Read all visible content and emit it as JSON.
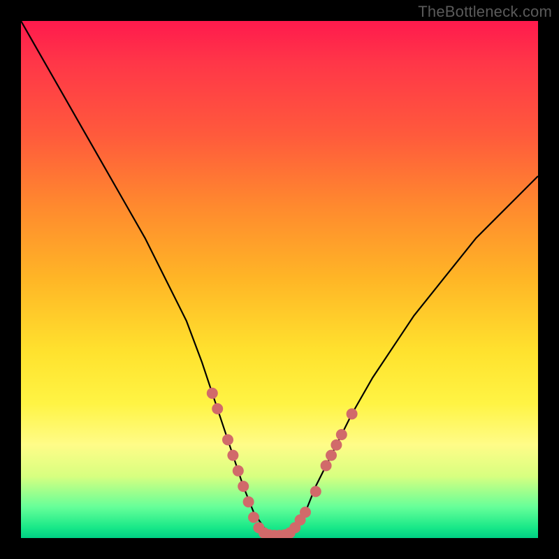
{
  "watermark": "TheBottleneck.com",
  "colors": {
    "curve_stroke": "#000000",
    "marker_fill": "#d16a6a",
    "marker_stroke": "#d16a6a"
  },
  "chart_data": {
    "type": "line",
    "title": "",
    "xlabel": "",
    "ylabel": "",
    "xlim": [
      0,
      100
    ],
    "ylim": [
      0,
      100
    ],
    "series": [
      {
        "name": "curve",
        "x": [
          0,
          4,
          8,
          12,
          16,
          20,
          24,
          28,
          32,
          35,
          37,
          39,
          41,
          43,
          45,
          47,
          49,
          51,
          53,
          55,
          57,
          60,
          64,
          68,
          72,
          76,
          80,
          84,
          88,
          92,
          96,
          100
        ],
        "y": [
          100,
          93,
          86,
          79,
          72,
          65,
          58,
          50,
          42,
          34,
          28,
          22,
          16,
          10,
          5,
          2,
          0.5,
          0.5,
          2,
          5,
          10,
          16,
          24,
          31,
          37,
          43,
          48,
          53,
          58,
          62,
          66,
          70
        ]
      }
    ],
    "markers": [
      {
        "x": 37,
        "y": 28
      },
      {
        "x": 38,
        "y": 25
      },
      {
        "x": 40,
        "y": 19
      },
      {
        "x": 41,
        "y": 16
      },
      {
        "x": 42,
        "y": 13
      },
      {
        "x": 43,
        "y": 10
      },
      {
        "x": 44,
        "y": 7
      },
      {
        "x": 45,
        "y": 4
      },
      {
        "x": 46,
        "y": 2
      },
      {
        "x": 47,
        "y": 1
      },
      {
        "x": 48,
        "y": 0.6
      },
      {
        "x": 49,
        "y": 0.5
      },
      {
        "x": 50,
        "y": 0.5
      },
      {
        "x": 51,
        "y": 0.6
      },
      {
        "x": 52,
        "y": 1
      },
      {
        "x": 53,
        "y": 2
      },
      {
        "x": 54,
        "y": 3.5
      },
      {
        "x": 55,
        "y": 5
      },
      {
        "x": 57,
        "y": 9
      },
      {
        "x": 59,
        "y": 14
      },
      {
        "x": 60,
        "y": 16
      },
      {
        "x": 61,
        "y": 18
      },
      {
        "x": 62,
        "y": 20
      },
      {
        "x": 64,
        "y": 24
      }
    ]
  }
}
